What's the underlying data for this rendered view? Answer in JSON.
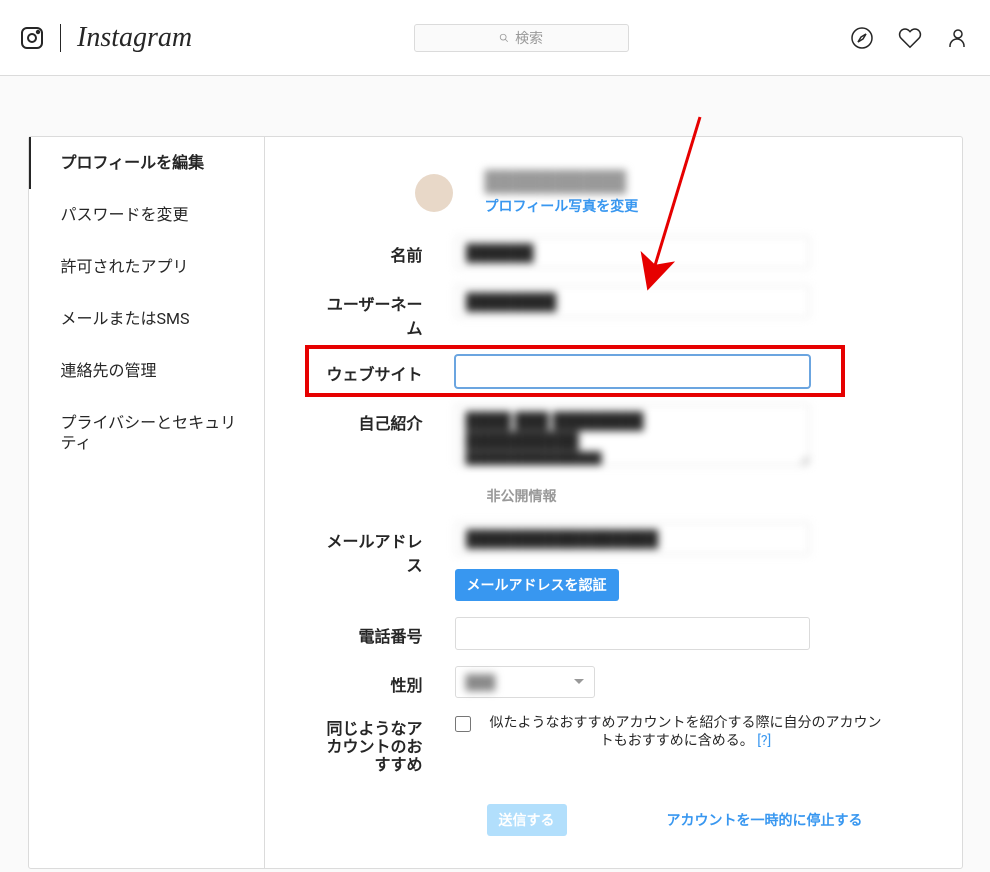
{
  "nav": {
    "wordmark": "Instagram",
    "search_placeholder": "検索"
  },
  "sidebar": {
    "items": [
      {
        "label": "プロフィールを編集",
        "active": true
      },
      {
        "label": "パスワードを変更",
        "active": false
      },
      {
        "label": "許可されたアプリ",
        "active": false
      },
      {
        "label": "メールまたはSMS",
        "active": false
      },
      {
        "label": "連絡先の管理",
        "active": false
      },
      {
        "label": "プライバシーとセキュリティ",
        "active": false
      }
    ]
  },
  "profile": {
    "username_display": "██████████",
    "change_photo_label": "プロフィール写真を変更"
  },
  "labels": {
    "name": "名前",
    "username": "ユーザーネーム",
    "website": "ウェブサイト",
    "bio": "自己紹介",
    "private_info": "非公開情報",
    "email": "メールアドレス",
    "phone": "電話番号",
    "gender": "性別",
    "similar_accounts": "同じようなアカウントのおすすめ"
  },
  "values": {
    "name": "██████",
    "username": "████████",
    "website": "",
    "bio": "████ ███ ████████\n██████████\n████████████",
    "email": "█████████████████",
    "phone": "",
    "gender": "███"
  },
  "buttons": {
    "confirm_email": "メールアドレスを認証",
    "submit": "送信する",
    "disable_account": "アカウントを一時的に停止する"
  },
  "suggestions": {
    "text": "似たようなおすすめアカウントを紹介する際に自分のアカウントもおすすめに含める。",
    "help": "[?]"
  }
}
